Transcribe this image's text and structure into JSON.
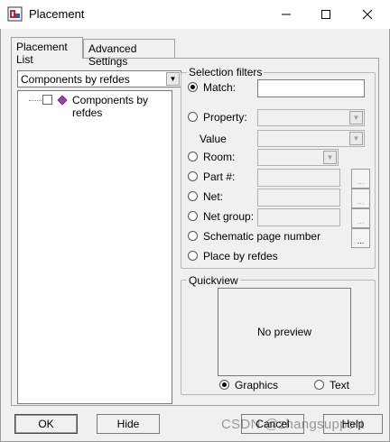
{
  "window": {
    "title": "Placement",
    "controls": {
      "minimize": "—",
      "maximize": "☐",
      "close": "✕"
    }
  },
  "tabs": [
    {
      "label": "Placement List"
    },
    {
      "label": "Advanced Settings"
    }
  ],
  "list": {
    "combo_value": "Components by refdes",
    "tree_items": [
      {
        "label": "Components by refdes",
        "checked": false
      }
    ]
  },
  "filters": {
    "title": "Selection filters",
    "match_label": "Match:",
    "match_value": "",
    "property_label": "Property:",
    "value_label": "Value",
    "room_label": "Room:",
    "partnum_label": "Part #:",
    "net_label": "Net:",
    "netgroup_label": "Net group:",
    "schematic_label": "Schematic page number",
    "placebyrefdes_label": "Place by refdes",
    "selected": "match",
    "dots": "..."
  },
  "quickview": {
    "title": "Quickview",
    "preview_text": "No preview",
    "graphics_label": "Graphics",
    "text_label": "Text",
    "selected": "graphics"
  },
  "buttons": {
    "ok": "OK",
    "hide": "Hide",
    "cancel": "Cancel",
    "help": "Help"
  },
  "watermark": "CSDN @zhangsupport",
  "colors": {
    "app_icon_red": "#c0282c",
    "tree_icon_purple": "#9b3fb5"
  }
}
